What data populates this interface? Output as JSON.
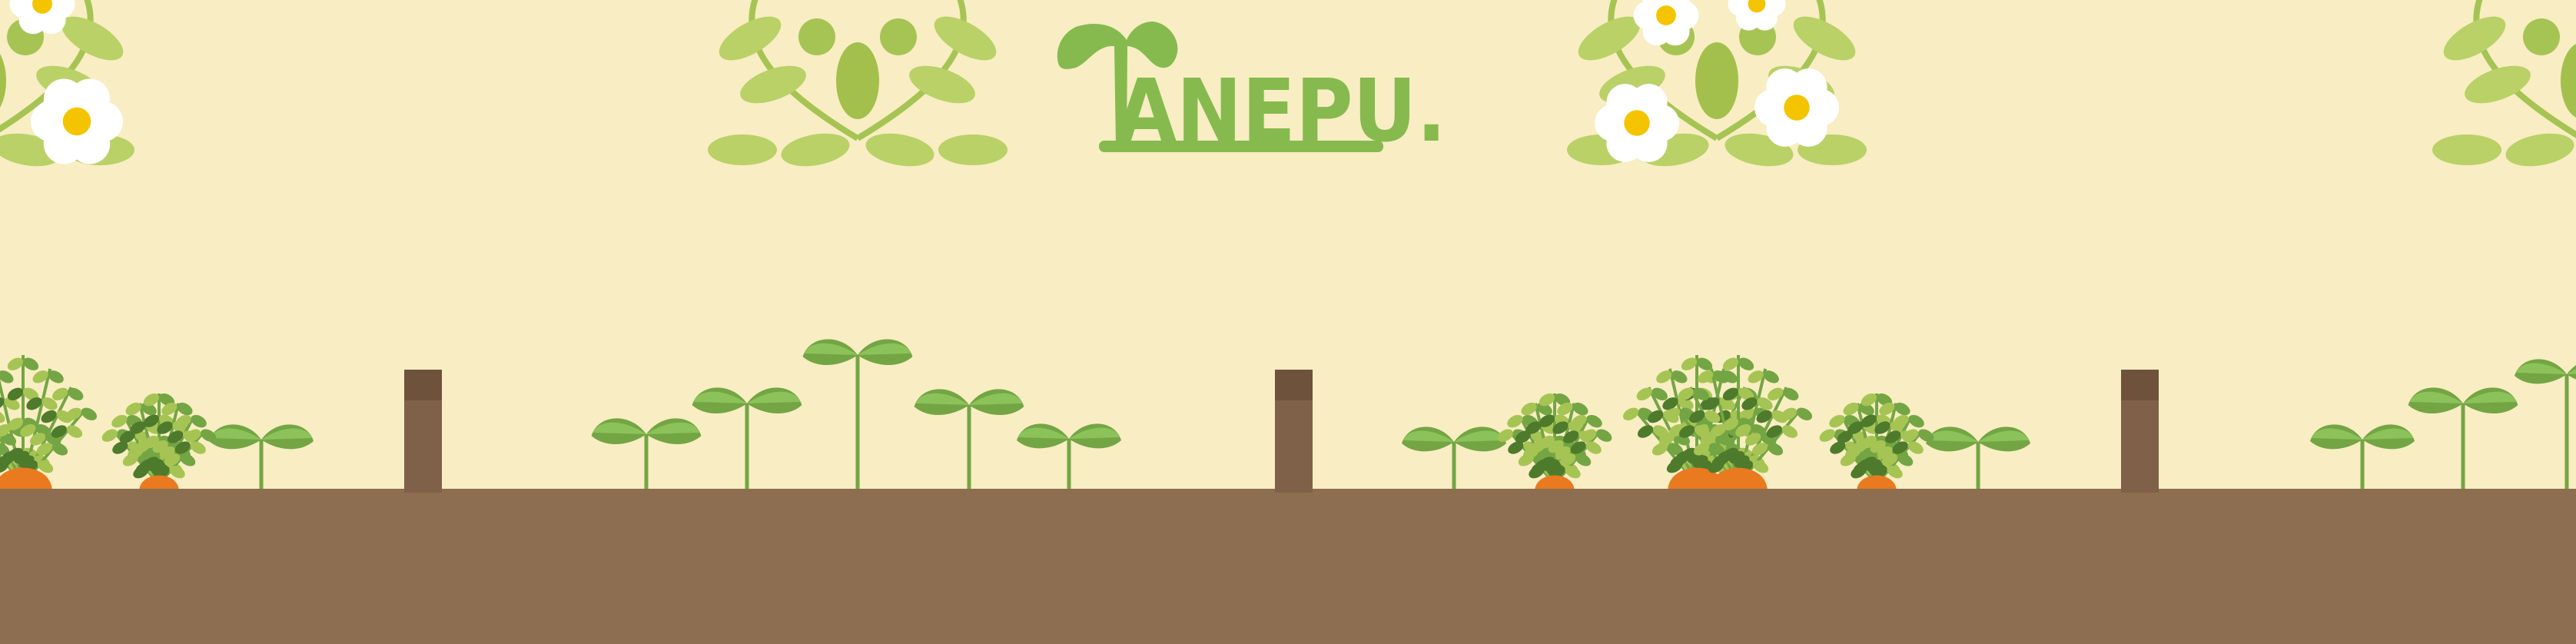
{
  "banner": {
    "logo_text": "TANEPU.",
    "colors": {
      "background": "#F8EDC3",
      "ground": "#8E6E50",
      "post": "#7F6048",
      "logo_green": "#86BA4E",
      "leaf_light": "#A6C453",
      "leaf_mid": "#74A544",
      "leaf_dark": "#4E7A2C",
      "carrot": "#E97A1F",
      "flower_center": "#F5C400",
      "flower_petal": "#FFFFFF"
    }
  }
}
